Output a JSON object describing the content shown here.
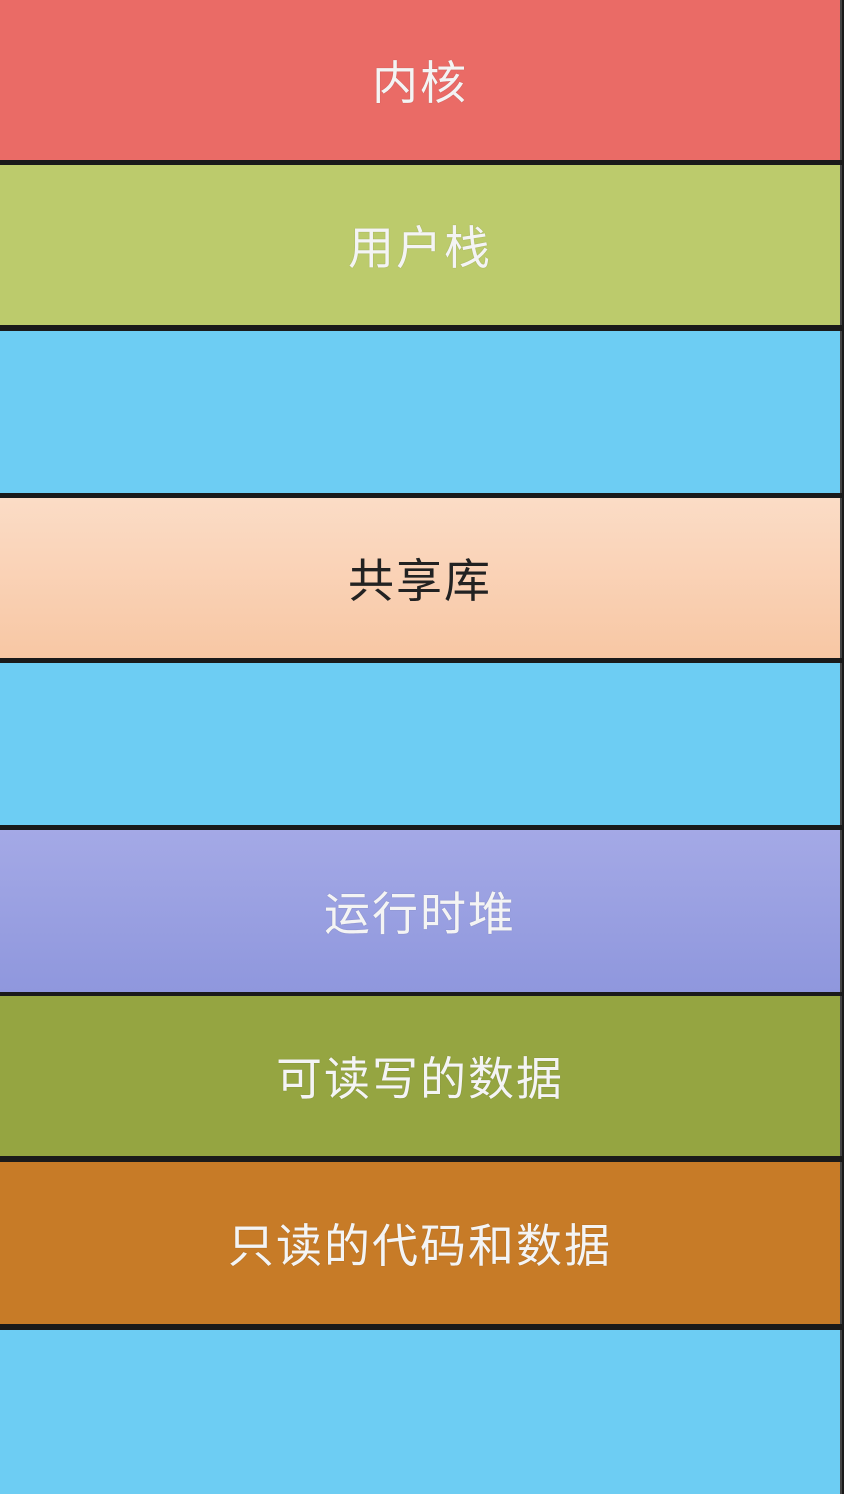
{
  "memory_layout": {
    "segments": [
      {
        "id": "kernel",
        "label": "内核",
        "color": "#ea6b66",
        "text": "light"
      },
      {
        "id": "user-stack",
        "label": "用户栈",
        "color": "#bccb6c",
        "text": "light"
      },
      {
        "id": "free-1",
        "label": "",
        "color": "#6dcdf3",
        "text": "light"
      },
      {
        "id": "shared-libs",
        "label": "共享库",
        "color": "#f8c7a4",
        "gradient_to": "#fbdcc6",
        "text": "dark"
      },
      {
        "id": "free-2",
        "label": "",
        "color": "#6dcdf3",
        "text": "light"
      },
      {
        "id": "runtime-heap",
        "label": "运行时堆",
        "color": "#8f97dd",
        "gradient_to": "#a4a9e6",
        "text": "light"
      },
      {
        "id": "rw-data",
        "label": "可读写的数据",
        "color": "#95a541",
        "text": "light"
      },
      {
        "id": "ro-code-data",
        "label": "只读的代码和数据",
        "color": "#c77b27",
        "text": "light"
      },
      {
        "id": "free-3",
        "label": "",
        "color": "#6dcdf3",
        "text": "light"
      }
    ]
  }
}
